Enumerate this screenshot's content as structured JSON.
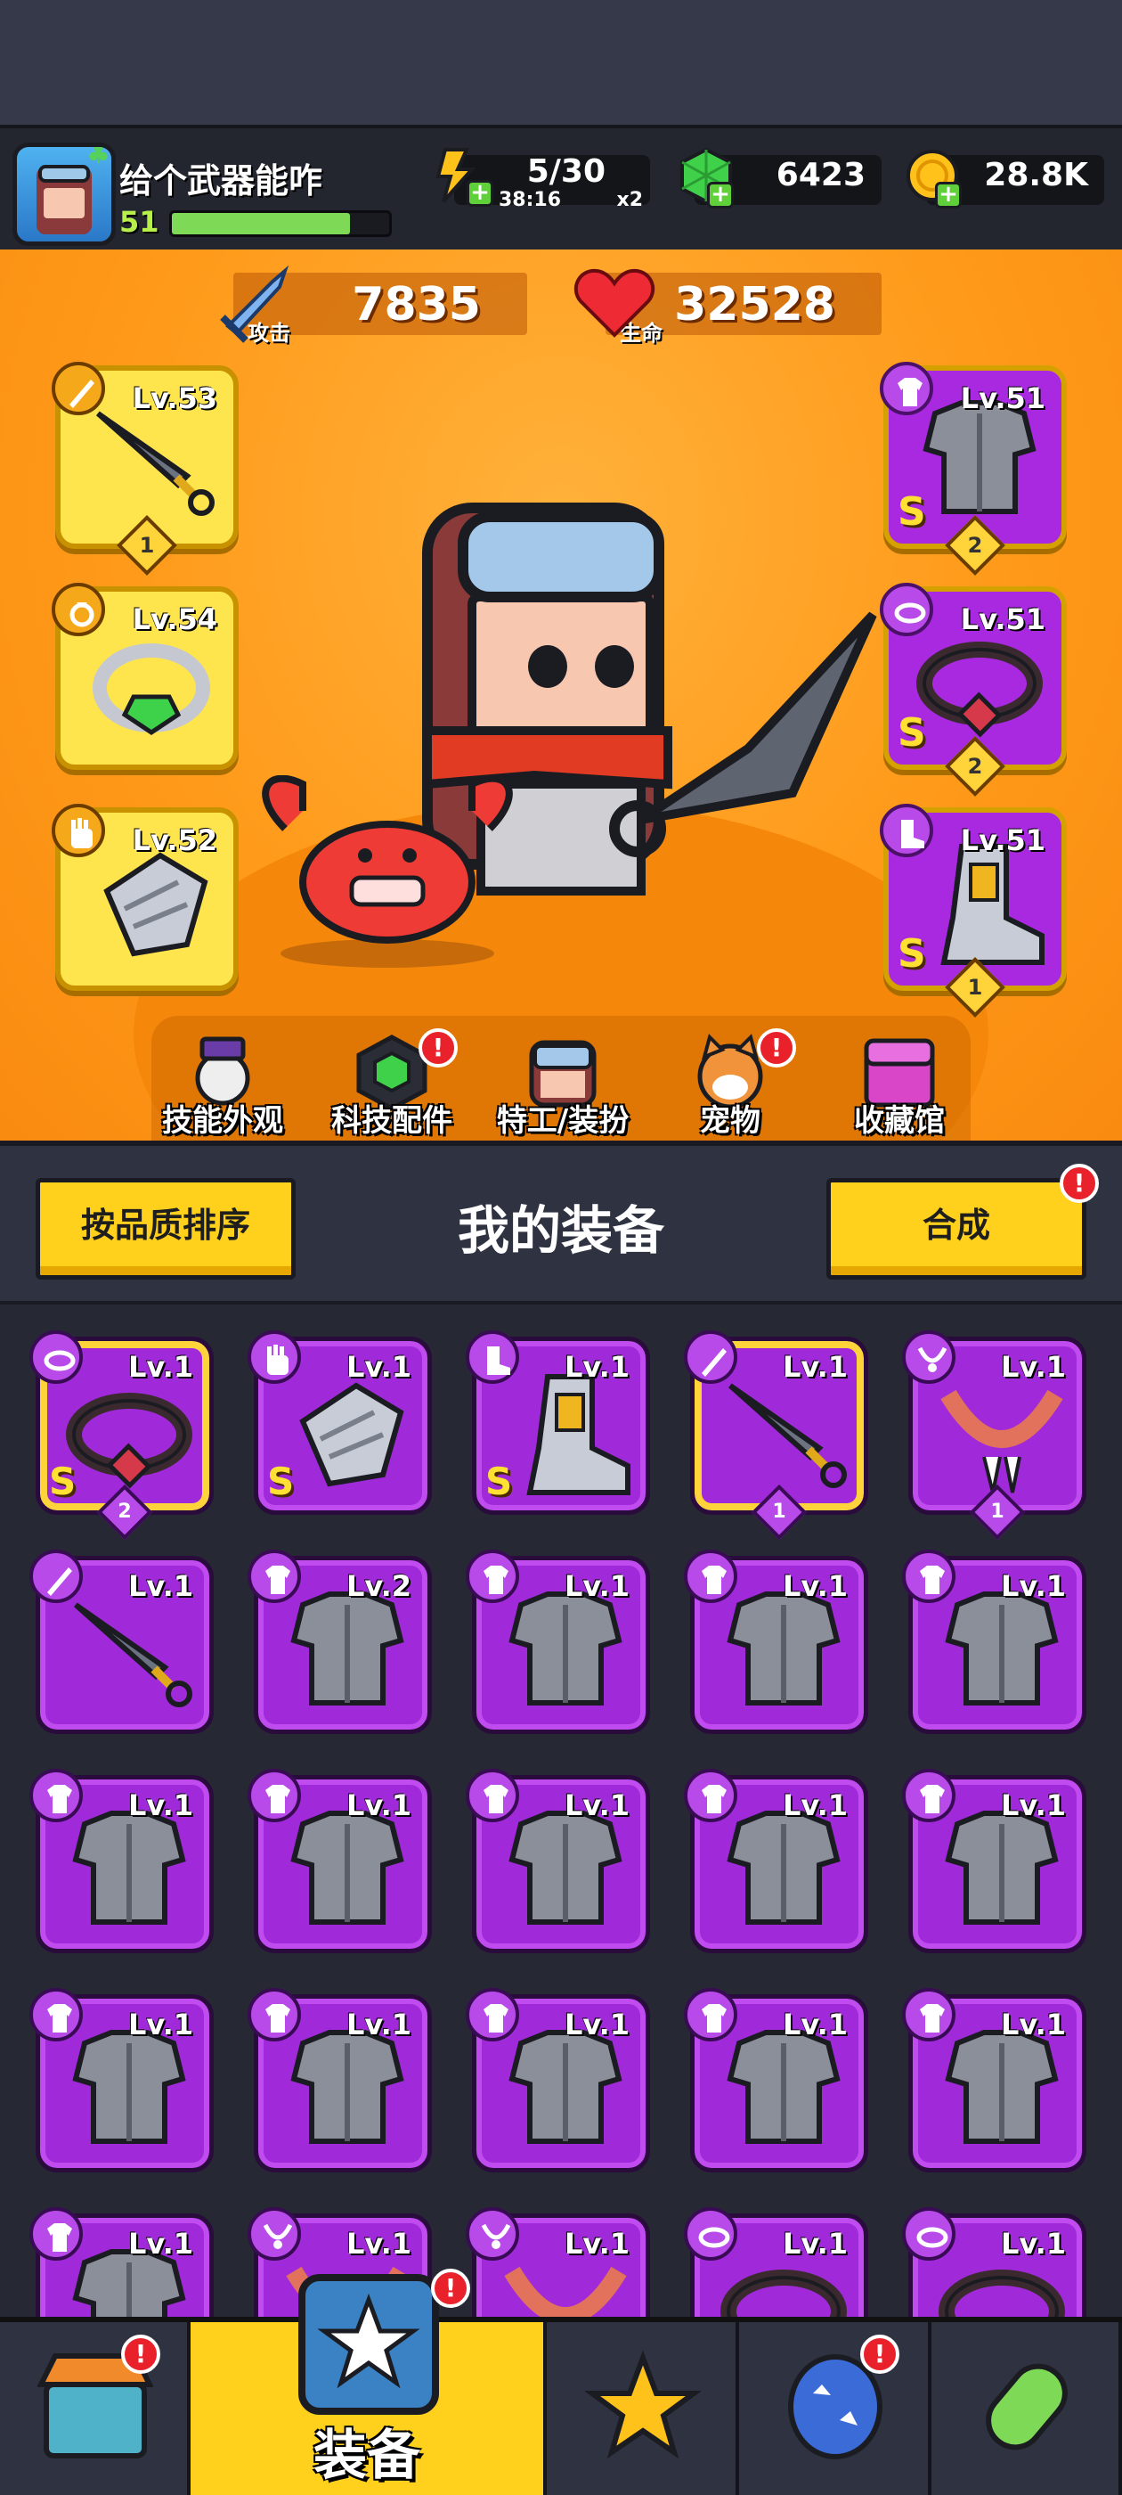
{
  "player": {
    "name": "给个武器能咋",
    "level": "51",
    "xp_fraction": 0.82
  },
  "resources": {
    "energy": {
      "value": "5/30",
      "timer": "38:16",
      "multiplier": "x2"
    },
    "gems": {
      "value": "6423"
    },
    "coins": {
      "value": "28.8K"
    }
  },
  "stats": {
    "attack": {
      "value": "7835",
      "label": "攻击"
    },
    "hp": {
      "value": "32528",
      "label": "生命"
    }
  },
  "equipped": [
    {
      "slot": "weapon",
      "level": "Lv.53",
      "count": "1",
      "grade": "",
      "icon": "kunai-icon"
    },
    {
      "slot": "ring",
      "level": "Lv.54",
      "count": "",
      "grade": "",
      "icon": "emerald-ring-icon"
    },
    {
      "slot": "glove",
      "level": "Lv.52",
      "count": "",
      "grade": "",
      "icon": "mech-glove-icon"
    },
    {
      "slot": "armor",
      "level": "Lv.51",
      "count": "2",
      "grade": "S",
      "icon": "mech-armor-icon"
    },
    {
      "slot": "belt",
      "level": "Lv.51",
      "count": "2",
      "grade": "S",
      "icon": "gem-belt-icon"
    },
    {
      "slot": "boots",
      "level": "Lv.51",
      "count": "1",
      "grade": "S",
      "icon": "mech-boots-icon"
    }
  ],
  "features": [
    {
      "label": "技能外观",
      "icon": "skill-skin-icon",
      "alert": false
    },
    {
      "label": "科技配件",
      "icon": "tech-part-icon",
      "alert": true
    },
    {
      "label": "特工/装扮",
      "icon": "agent-icon",
      "alert": false
    },
    {
      "label": "宠物",
      "icon": "shiba-pet-icon",
      "alert": true
    },
    {
      "label": "收藏馆",
      "icon": "collection-chest-icon",
      "alert": false
    }
  ],
  "inventory_header": {
    "sort_label": "按品质排序",
    "title": "我的装备",
    "merge_label": "合成",
    "merge_alert": true
  },
  "inventory": [
    {
      "level": "Lv.1",
      "slot": "belt",
      "grade": "S",
      "count": "2",
      "border": "yellow"
    },
    {
      "level": "Lv.1",
      "slot": "glove",
      "grade": "S",
      "count": "",
      "border": ""
    },
    {
      "level": "Lv.1",
      "slot": "boots",
      "grade": "S",
      "count": "",
      "border": ""
    },
    {
      "level": "Lv.1",
      "slot": "weapon",
      "grade": "",
      "count": "1",
      "border": "yellow"
    },
    {
      "level": "Lv.1",
      "slot": "necklace",
      "grade": "",
      "count": "1",
      "border": ""
    },
    {
      "level": "Lv.1",
      "slot": "weapon",
      "grade": "",
      "count": "",
      "border": ""
    },
    {
      "level": "Lv.2",
      "slot": "armor",
      "grade": "",
      "count": "",
      "border": ""
    },
    {
      "level": "Lv.1",
      "slot": "armor",
      "grade": "",
      "count": "",
      "border": ""
    },
    {
      "level": "Lv.1",
      "slot": "armor",
      "grade": "",
      "count": "",
      "border": ""
    },
    {
      "level": "Lv.1",
      "slot": "armor",
      "grade": "",
      "count": "",
      "border": ""
    },
    {
      "level": "Lv.1",
      "slot": "armor",
      "grade": "",
      "count": "",
      "border": ""
    },
    {
      "level": "Lv.1",
      "slot": "armor",
      "grade": "",
      "count": "",
      "border": ""
    },
    {
      "level": "Lv.1",
      "slot": "armor",
      "grade": "",
      "count": "",
      "border": ""
    },
    {
      "level": "Lv.1",
      "slot": "armor",
      "grade": "",
      "count": "",
      "border": ""
    },
    {
      "level": "Lv.1",
      "slot": "armor",
      "grade": "",
      "count": "",
      "border": ""
    },
    {
      "level": "Lv.1",
      "slot": "armor",
      "grade": "",
      "count": "",
      "border": ""
    },
    {
      "level": "Lv.1",
      "slot": "armor",
      "grade": "",
      "count": "",
      "border": ""
    },
    {
      "level": "Lv.1",
      "slot": "armor",
      "grade": "",
      "count": "",
      "border": ""
    },
    {
      "level": "Lv.1",
      "slot": "armor",
      "grade": "",
      "count": "",
      "border": ""
    },
    {
      "level": "Lv.1",
      "slot": "armor",
      "grade": "",
      "count": "",
      "border": ""
    },
    {
      "level": "Lv.1",
      "slot": "armor",
      "grade": "",
      "count": "",
      "border": ""
    },
    {
      "level": "Lv.1",
      "slot": "necklace",
      "grade": "",
      "count": "",
      "border": ""
    },
    {
      "level": "Lv.1",
      "slot": "necklace",
      "grade": "",
      "count": "",
      "border": ""
    },
    {
      "level": "Lv.1",
      "slot": "belt",
      "grade": "",
      "count": "",
      "border": ""
    },
    {
      "level": "Lv.1",
      "slot": "belt",
      "grade": "",
      "count": "",
      "border": ""
    }
  ],
  "nav": [
    {
      "label": "",
      "icon": "shop-icon",
      "alert": true,
      "active": false
    },
    {
      "label": "装备",
      "icon": "equipment-icon",
      "alert": true,
      "active": true
    },
    {
      "label": "",
      "icon": "battle-star-icon",
      "alert": false,
      "active": false
    },
    {
      "label": "",
      "icon": "egg-icon",
      "alert": true,
      "active": false
    },
    {
      "label": "",
      "icon": "evolve-capsule-icon",
      "alert": false,
      "active": false
    }
  ],
  "colors": {
    "hero_bg": "#ff9a1a",
    "item_purple": "#a02ad9",
    "button_yellow": "#ffd01c",
    "alert_red": "#e9212b",
    "xp_green": "#7ed957"
  }
}
